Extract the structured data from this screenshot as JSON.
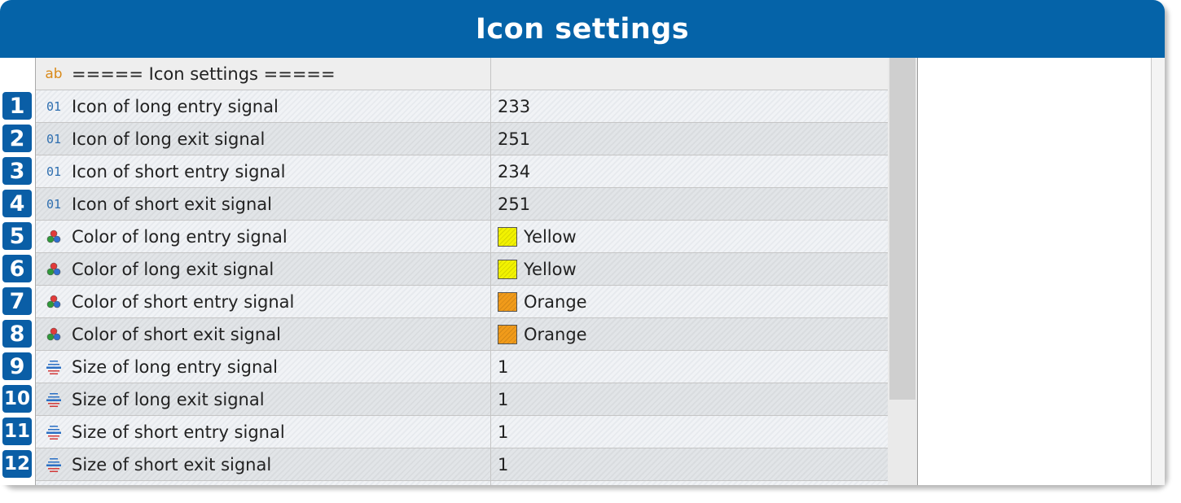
{
  "window": {
    "title": "Icon settings"
  },
  "colors": {
    "header_bg": "#0563a8",
    "badge_bg": "#0a5ea6",
    "yellow": "#f2f200",
    "orange": "#f19b1a"
  },
  "rows": [
    {
      "icon": "ab-icon",
      "icon_text": "ab",
      "name": "===== Icon settings =====",
      "value": ""
    },
    {
      "num": "1",
      "icon": "integer-icon",
      "icon_text": "01",
      "name": "Icon of long entry signal",
      "value": "233"
    },
    {
      "num": "2",
      "icon": "integer-icon",
      "icon_text": "01",
      "name": "Icon of long exit signal",
      "value": "251"
    },
    {
      "num": "3",
      "icon": "integer-icon",
      "icon_text": "01",
      "name": "Icon of short entry signal",
      "value": "234"
    },
    {
      "num": "4",
      "icon": "integer-icon",
      "icon_text": "01",
      "name": "Icon of short exit signal",
      "value": "251"
    },
    {
      "num": "5",
      "icon": "color-palette-icon",
      "name": "Color of long entry signal",
      "value": "Yellow",
      "swatch": "#f2f200"
    },
    {
      "num": "6",
      "icon": "color-palette-icon",
      "name": "Color of long exit signal",
      "value": "Yellow",
      "swatch": "#f2f200"
    },
    {
      "num": "7",
      "icon": "color-palette-icon",
      "name": "Color of short entry signal",
      "value": "Orange",
      "swatch": "#f19b1a"
    },
    {
      "num": "8",
      "icon": "color-palette-icon",
      "name": "Color of short exit signal",
      "value": "Orange",
      "swatch": "#f19b1a"
    },
    {
      "num": "9",
      "icon": "line-width-icon",
      "name": "Size of long entry signal",
      "value": "1"
    },
    {
      "num": "10",
      "icon": "line-width-icon",
      "name": "Size of long exit signal",
      "value": "1"
    },
    {
      "num": "11",
      "icon": "line-width-icon",
      "name": "Size of short entry signal",
      "value": "1"
    },
    {
      "num": "12",
      "icon": "line-width-icon",
      "name": "Size of short exit signal",
      "value": "1"
    }
  ]
}
